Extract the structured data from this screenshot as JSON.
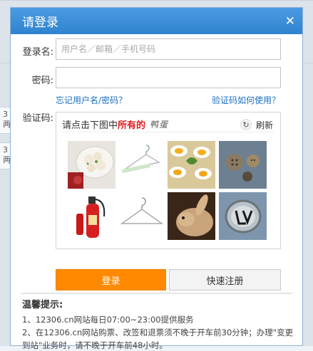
{
  "background": {
    "row_snippets": [
      "3\n两",
      "3\n两"
    ]
  },
  "dialog": {
    "title": "请登录",
    "close_glyph": "✕"
  },
  "form": {
    "username_label": "登录名:",
    "username_placeholder": "用户名／邮箱／手机号码",
    "password_label": "密码:",
    "password_placeholder": "",
    "forgot_link": "忘记用户名/密码？",
    "captcha_help_link": "验证码如何使用？",
    "captcha_label": "验证码:"
  },
  "captcha": {
    "prompt_prefix": "请点击下图中",
    "prompt_highlight": "所有的",
    "target_word": "鸭蛋",
    "refresh_label": "刷新",
    "tiles": [
      {
        "name": "dumplings-image"
      },
      {
        "name": "clothes-hanger-image"
      },
      {
        "name": "deviled-eggs-image"
      },
      {
        "name": "buttons-image"
      },
      {
        "name": "fire-extinguisher-image"
      },
      {
        "name": "wire-hanger-image"
      },
      {
        "name": "rabbit-image"
      },
      {
        "name": "logo-badge-image"
      }
    ]
  },
  "buttons": {
    "login": "登录",
    "register": "快速注册"
  },
  "tips": {
    "title": "温馨提示:",
    "lines": [
      "1、12306.cn网站每日07:00~23:00提供服务",
      "2、在12306.cn网站购票、改签和退票须不晚于开车前30分钟；办理\"变更",
      "到站\"业务时，请不晚于开车前48小时。"
    ]
  },
  "colors": {
    "title_bar": "#3b8ed8",
    "login_button": "#ff8a00",
    "link": "#1a6fc0",
    "highlight": "#e01b1b"
  }
}
